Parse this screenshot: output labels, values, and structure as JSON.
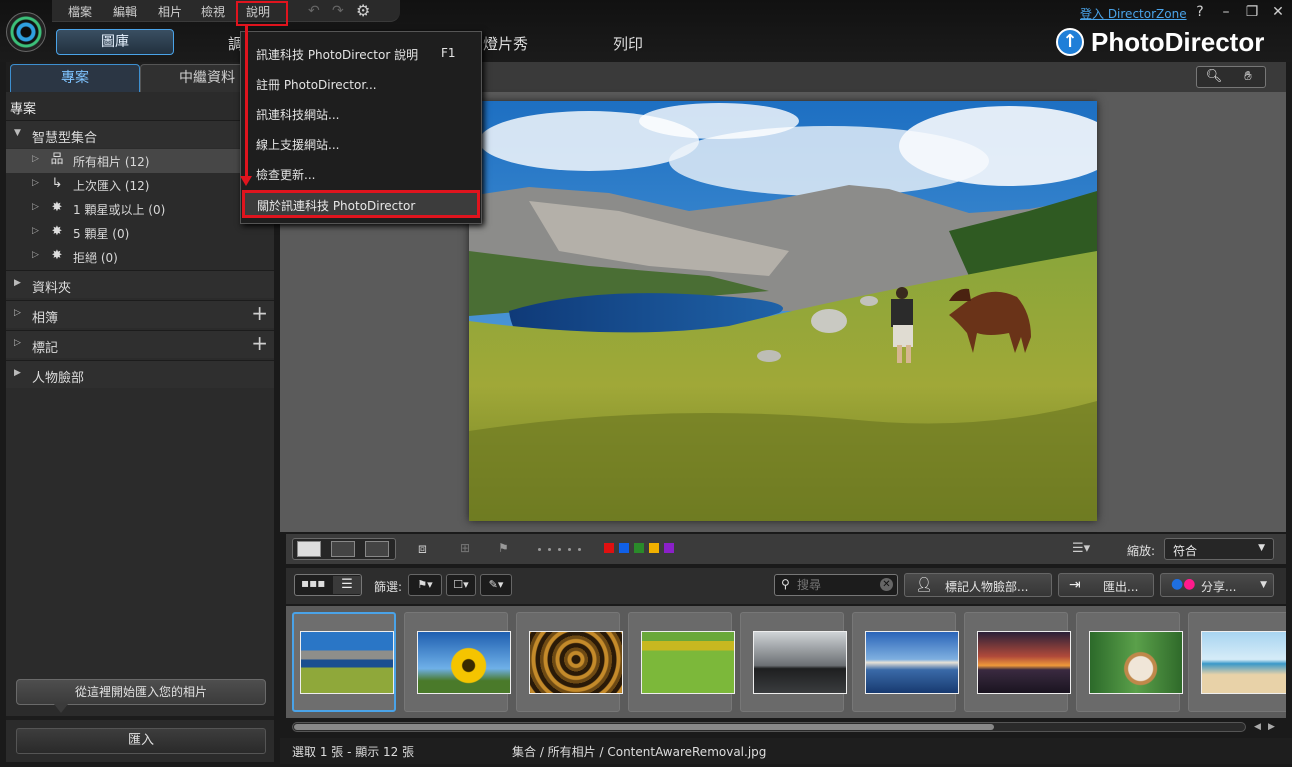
{
  "menubar": {
    "items": [
      "檔案",
      "編輯",
      "相片",
      "檢視",
      "說明"
    ]
  },
  "top_tabs": {
    "library": "圖庫",
    "edit_partial": "調",
    "slideshow_partial": "燈片秀",
    "print": "列印"
  },
  "header": {
    "director_zone_link": "登入 DirectorZone",
    "help_glyph": "?",
    "brand": "PhotoDirector"
  },
  "panel": {
    "tabs": [
      "專案",
      "中繼資料"
    ],
    "title": "專案",
    "smart_collections": "智慧型集合",
    "items": [
      {
        "label": "所有相片 (12)",
        "icon": "tree-icon"
      },
      {
        "label": "上次匯入 (12)",
        "icon": "import-icon"
      },
      {
        "label": "1 顆星或以上 (0)",
        "icon": "star-icon"
      },
      {
        "label": "5 顆星 (0)",
        "icon": "star-icon"
      },
      {
        "label": "拒絕 (0)",
        "icon": "reject-icon"
      }
    ],
    "sections": [
      "資料夾",
      "相簿",
      "標記",
      "人物臉部"
    ],
    "import_hint": "從這裡開始匯入您的相片",
    "import_button": "匯入"
  },
  "help_menu": {
    "items": [
      "訊連科技 PhotoDirector 說明",
      "註冊 PhotoDirector...",
      "訊連科技網站...",
      "線上支援網站...",
      "檢查更新...",
      "關於訊連科技 PhotoDirector"
    ],
    "shortcut": "F1",
    "highlight_color": "#e0141e"
  },
  "viewer_toolbar": {
    "zoom_label": "縮放:",
    "zoom_value": "符合",
    "color_labels": [
      "#e01010",
      "#1060e8",
      "#2a8a2a",
      "#f0b000",
      "#8a20c8"
    ]
  },
  "filter_bar": {
    "filter_label": "篩選:",
    "search_placeholder": "搜尋",
    "tag_faces": "標記人物臉部...",
    "export": "匯出...",
    "share": "分享..."
  },
  "thumbnails": {
    "count": 12,
    "visible": 9,
    "selected_index": 0
  },
  "status": {
    "selection": "選取 1 張 - 顯示 12 張",
    "path": "集合 / 所有相片 / ContentAwareRemoval.jpg"
  },
  "colors": {
    "accent": "#4aa3e8",
    "annotation": "#e0141e"
  }
}
